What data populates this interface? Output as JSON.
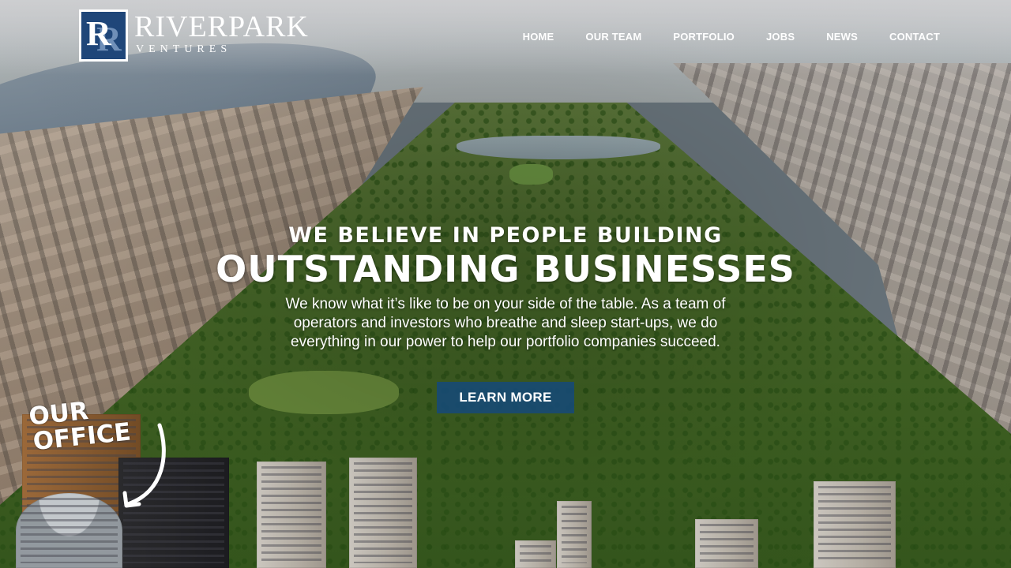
{
  "header": {
    "logo": {
      "mark": "R",
      "name": "RIVERPARK",
      "sub": "VENTURES"
    },
    "nav": [
      {
        "label": "HOME"
      },
      {
        "label": "OUR TEAM"
      },
      {
        "label": "PORTFOLIO"
      },
      {
        "label": "JOBS"
      },
      {
        "label": "NEWS"
      },
      {
        "label": "CONTACT"
      }
    ]
  },
  "hero": {
    "pre_title": "WE BELIEVE IN PEOPLE BUILDING",
    "title": "OUTSTANDING BUSINESSES",
    "body": "We know what it’s like to be on your side of the table. As a team of operators and investors who breathe and sleep start-ups, we do everything in our power to help our portfolio companies succeed.",
    "cta_label": "LEARN MORE"
  },
  "annotation": {
    "line1": "OUR",
    "line2": "OFFICE"
  },
  "colors": {
    "brand_navy": "#1f4679",
    "cta_blue": "#164a78",
    "nav_text": "#ffffff"
  },
  "icons": {
    "office_arrow": "curved-arrow-down-left-icon"
  }
}
